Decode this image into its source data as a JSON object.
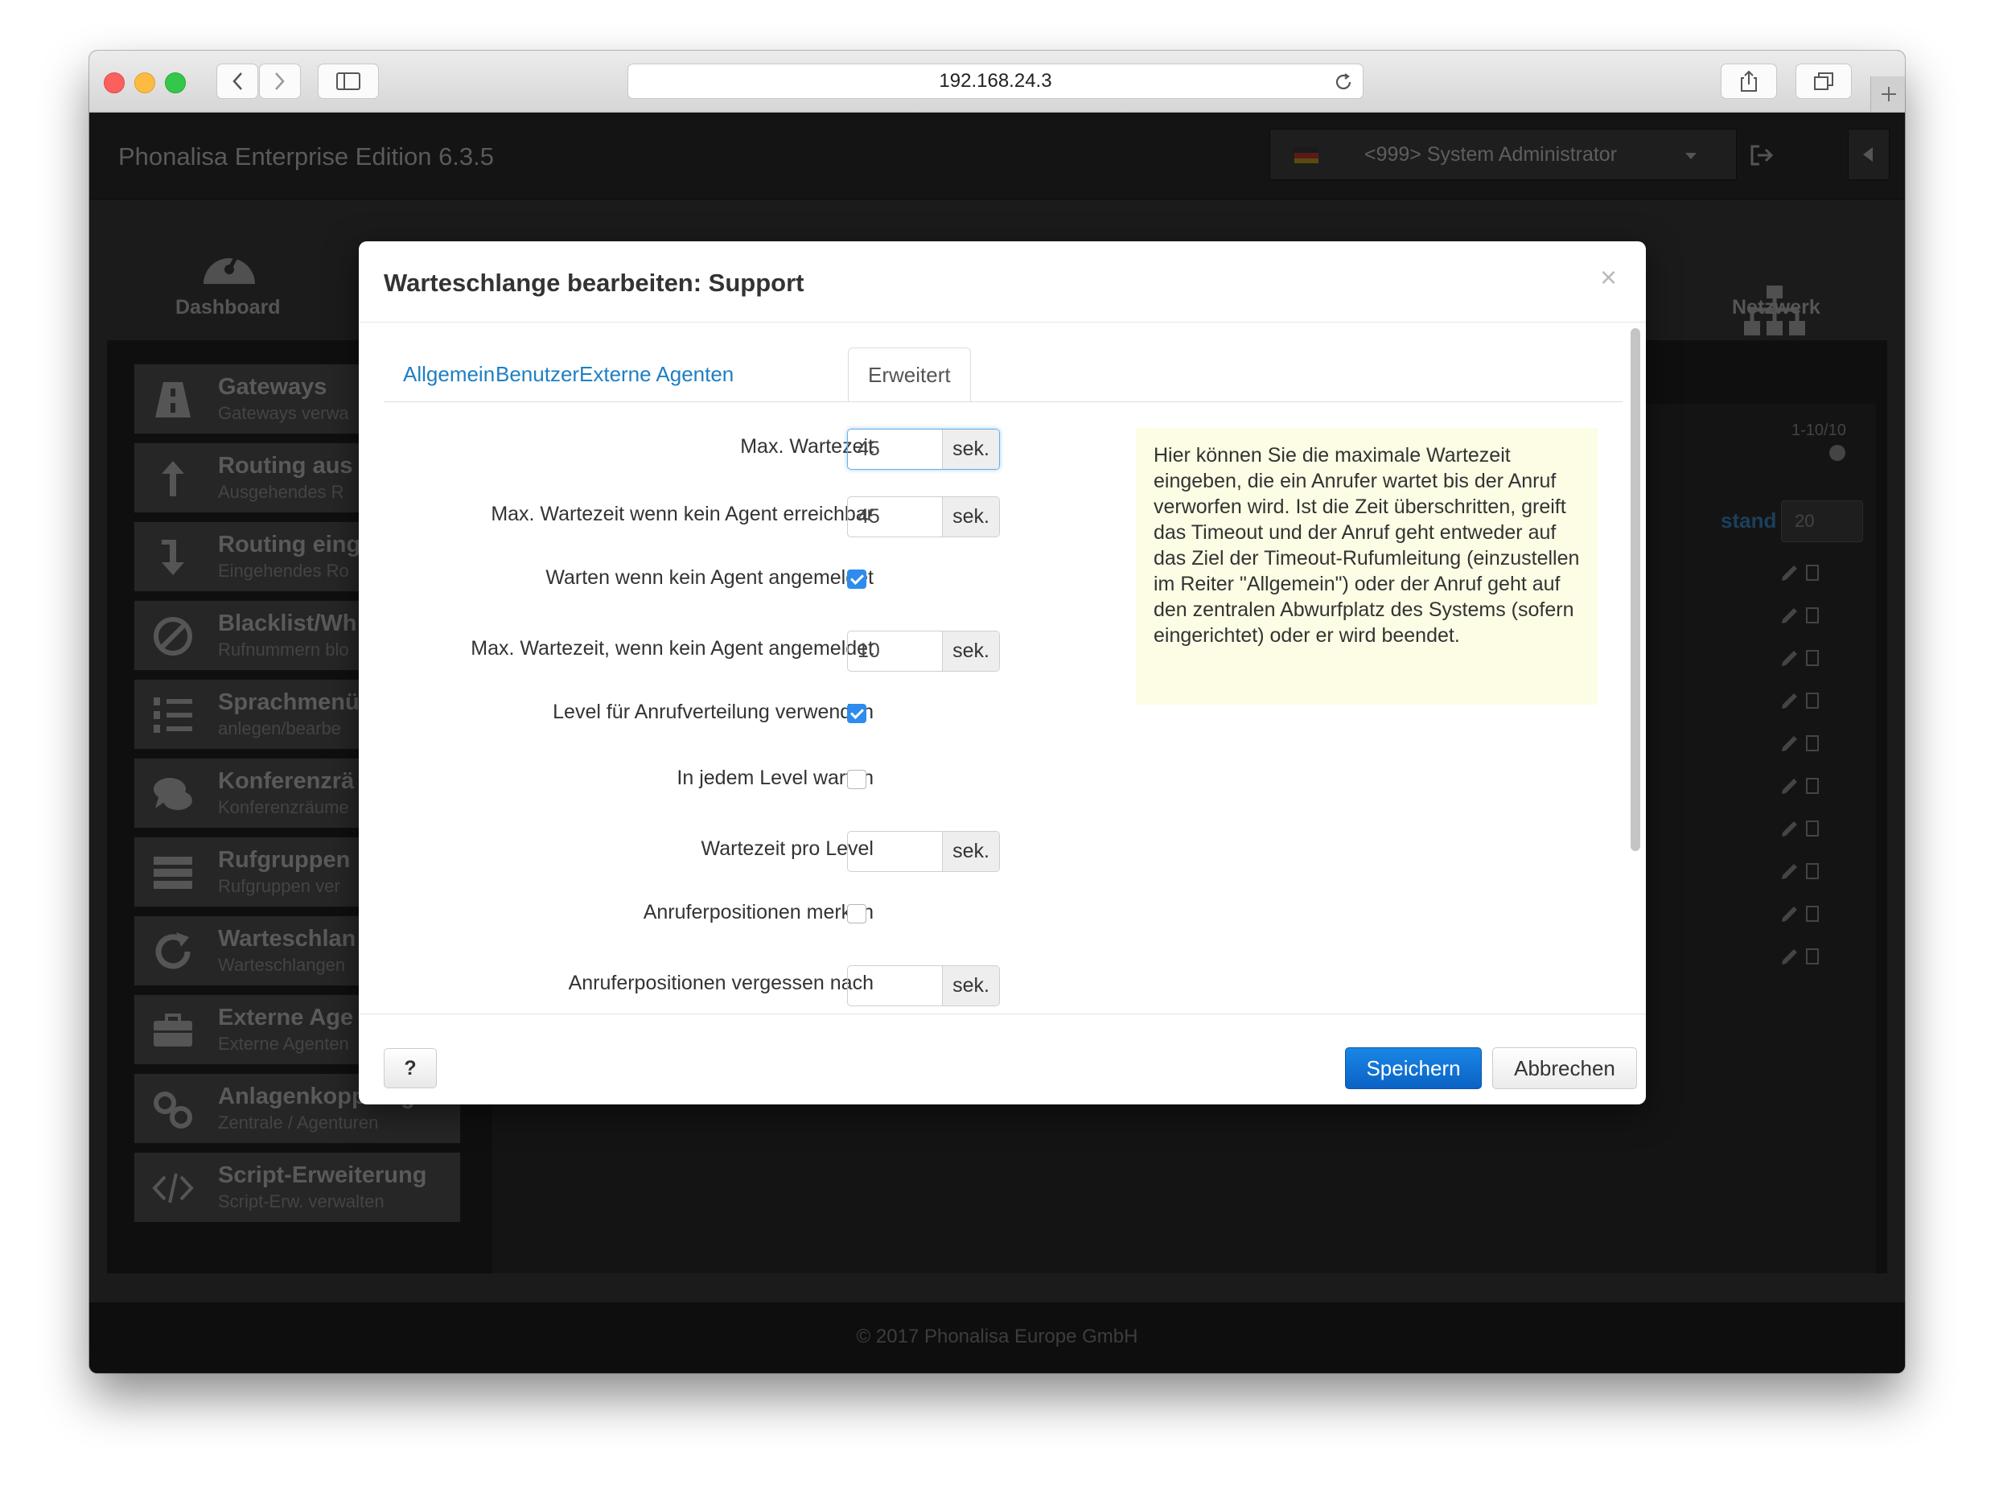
{
  "browser": {
    "url": "192.168.24.3"
  },
  "app": {
    "title": "Phonalisa Enterprise Edition 6.3.5",
    "user": "<999> System Administrator",
    "nav": {
      "dashboard": "Dashboard",
      "network": "Netzwerk"
    },
    "footer": "© 2017 Phonalisa Europe GmbH",
    "pagination": "1-10/10",
    "table_col_fragment": "stand",
    "page_size": "20"
  },
  "sidebar": {
    "items": [
      {
        "title": "Gateways",
        "sub": "Gateways verwa"
      },
      {
        "title": "Routing aus",
        "sub": "Ausgehendes R"
      },
      {
        "title": "Routing eing",
        "sub": "Eingehendes Ro"
      },
      {
        "title": "Blacklist/Wh",
        "sub": "Rufnummern blo"
      },
      {
        "title": "Sprachmenü",
        "sub": "anlegen/bearbe"
      },
      {
        "title": "Konferenzrä",
        "sub": "Konferenzräume"
      },
      {
        "title": "Rufgruppen",
        "sub": "Rufgruppen ver"
      },
      {
        "title": "Warteschlan",
        "sub": "Warteschlangen"
      },
      {
        "title": "Externe Age",
        "sub": "Externe Agenten"
      },
      {
        "title": "Anlagenkopplung",
        "sub": "Zentrale / Agenturen"
      },
      {
        "title": "Script-Erweiterung",
        "sub": "Script-Erw. verwalten"
      }
    ]
  },
  "modal": {
    "title": "Warteschlange bearbeiten: Support",
    "tabs": [
      "Allgemein",
      "Benutzer",
      "Externe Agenten",
      "Erweitert"
    ],
    "active_tab": "Erweitert",
    "fields": {
      "max_wait": {
        "label": "Max. Wartezeit",
        "value": "45",
        "unit": "sek."
      },
      "max_wait_unreachable": {
        "label": "Max. Wartezeit wenn kein Agent erreichbar",
        "value": "45",
        "unit": "sek."
      },
      "wait_no_agent": {
        "label": "Warten wenn kein Agent angemeldet",
        "checked": true
      },
      "max_wait_no_agent": {
        "label": "Max. Wartezeit, wenn kein Agent angemeldet",
        "value": "10",
        "unit": "sek."
      },
      "use_levels": {
        "label": "Level für Anrufverteilung verwenden",
        "checked": true
      },
      "wait_each_level": {
        "label": "In jedem Level warten",
        "checked": false
      },
      "wait_per_level": {
        "label": "Wartezeit pro Level",
        "value": "",
        "unit": "sek."
      },
      "remember_positions": {
        "label": "Anruferpositionen merken",
        "checked": false
      },
      "forget_positions": {
        "label": "Anruferpositionen vergessen nach",
        "value": "",
        "unit": "sek."
      }
    },
    "help_text": "Hier können Sie die maximale Wartezeit eingeben, die ein Anrufer wartet bis der Anruf verworfen wird. Ist die Zeit überschritten, greift das Timeout und der Anruf geht entweder auf das Ziel der Timeout-Rufumleitung (einzustellen im Reiter \"Allgemein\") oder der Anruf geht auf den zentralen Abwurfplatz des Systems (sofern eingerichtet) oder er wird beendet.",
    "buttons": {
      "help": "?",
      "save": "Speichern",
      "cancel": "Abbrechen"
    }
  },
  "colors": {
    "accent": "#1e7fc4",
    "primary_button": "#0a62c4",
    "checkbox_on": "#2d8ced",
    "help_bg": "#fdfde5"
  }
}
